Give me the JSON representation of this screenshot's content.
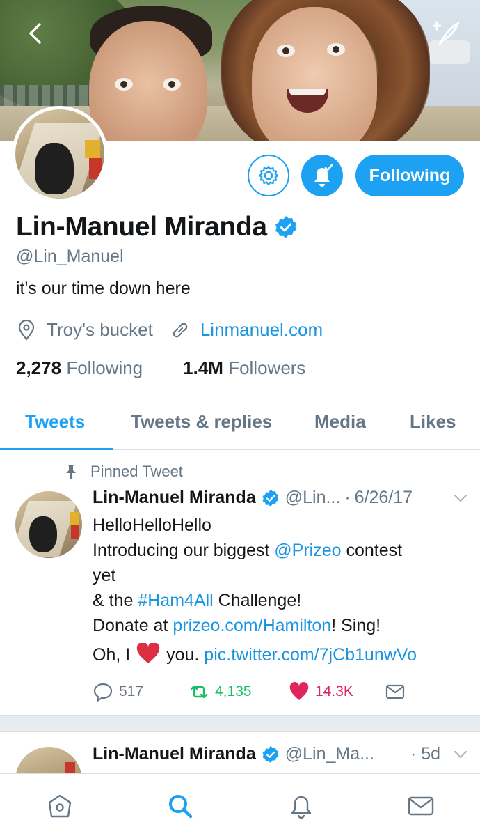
{
  "colors": {
    "accent": "#1da1f2",
    "text": "#14171a",
    "secondary": "#657786",
    "retweet": "#17bf63",
    "like": "#e0245e"
  },
  "header": {
    "back_icon": "chevron-left-icon",
    "compose_icon": "compose-tweet-icon"
  },
  "profile": {
    "name": "Lin-Manuel Miranda",
    "verified": true,
    "handle": "@Lin_Manuel",
    "bio": "it's our time down here",
    "location": "Troy's bucket",
    "website": "Linmanuel.com",
    "following_count": "2,278",
    "following_label": "Following",
    "followers_count": "1.4M",
    "followers_label": "Followers",
    "follow_button": "Following"
  },
  "tabs": [
    {
      "label": "Tweets",
      "active": true
    },
    {
      "label": "Tweets & replies",
      "active": false
    },
    {
      "label": "Media",
      "active": false
    },
    {
      "label": "Likes",
      "active": false
    }
  ],
  "pinned_tweet": {
    "pinned_label": "Pinned Tweet",
    "author": "Lin-Manuel Miranda",
    "handle": "@Lin...",
    "sep": "·",
    "date": "6/26/17",
    "lines": {
      "l1": "HelloHelloHello",
      "l2a": "Introducing our biggest ",
      "l2b": "@Prizeo",
      "l2c": " contest",
      "l3": "yet",
      "l4a": "& the ",
      "l4b": "#Ham4All",
      "l4c": " Challenge!",
      "l5a": "Donate at ",
      "l5b": "prizeo.com/Hamilton",
      "l5c": "! Sing!",
      "l6a": "Oh, I ",
      "l6b": " you. ",
      "l6c": "pic.twitter.com/7jCb1unwVo"
    },
    "replies": "517",
    "retweets": "4,135",
    "likes": "14.3K"
  },
  "second_tweet": {
    "author": "Lin-Manuel Miranda",
    "handle": "@Lin_Ma...",
    "sep": "·",
    "date": "5d"
  },
  "bottom_nav": [
    "home-icon",
    "search-icon",
    "notifications-icon",
    "messages-icon"
  ]
}
